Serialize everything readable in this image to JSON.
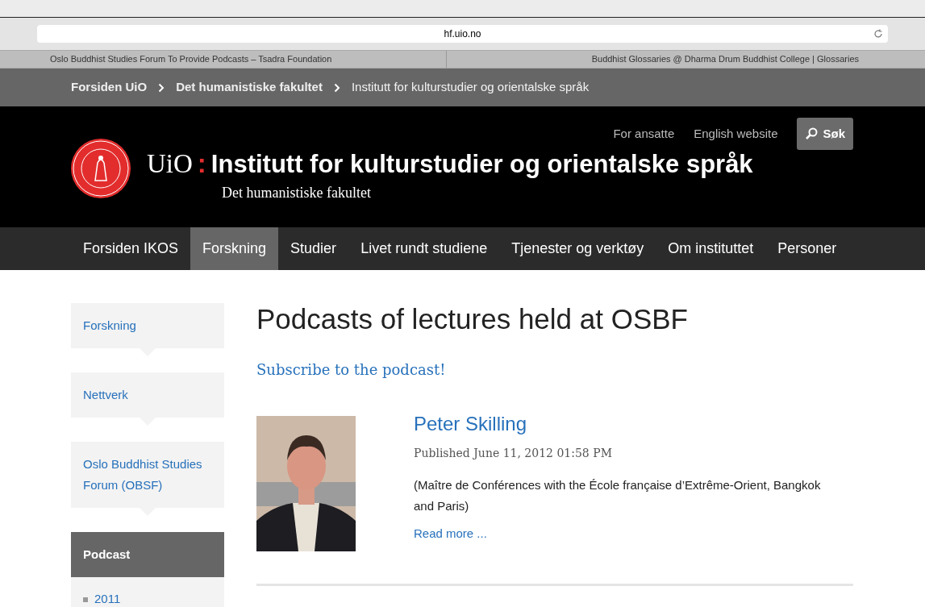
{
  "browser": {
    "address": "hf.uio.no",
    "tabs": [
      {
        "title": "Oslo Buddhist Studies Forum To Provide Podcasts – Tsadra Foundation"
      },
      {
        "title": "Buddhist Glossaries @ Dharma Drum Buddhist College | Glossaries"
      }
    ]
  },
  "breadcrumb": [
    {
      "label": "Forsiden UiO",
      "link": true
    },
    {
      "label": "Det humanistiske fakultet",
      "link": true
    },
    {
      "label": "Institutt for kulturstudier og orientalske språk",
      "link": false
    }
  ],
  "header": {
    "top_links": [
      "For ansatte",
      "English website"
    ],
    "search_button": "Søk",
    "brand": "UiO",
    "separator": ":",
    "title": "Institutt for kulturstudier og orientalske språk",
    "subtitle": "Det humanistiske fakultet"
  },
  "nav": [
    {
      "label": "Forsiden IKOS",
      "selected": false
    },
    {
      "label": "Forskning",
      "selected": true
    },
    {
      "label": "Studier",
      "selected": false
    },
    {
      "label": "Livet rundt studiene",
      "selected": false
    },
    {
      "label": "Tjenester og verktøy",
      "selected": false
    },
    {
      "label": "Om instituttet",
      "selected": false
    },
    {
      "label": "Personer",
      "selected": false
    }
  ],
  "sidebar": [
    {
      "label": "Forskning",
      "selected": false
    },
    {
      "label": "Nettverk",
      "selected": false
    },
    {
      "label": "Oslo Buddhist Studies Forum (OBSF)",
      "selected": false
    },
    {
      "label": "Podcast",
      "selected": true,
      "children": [
        {
          "label": "2011",
          "selected": false
        }
      ]
    }
  ],
  "main": {
    "heading": "Podcasts of lectures held at OSBF",
    "subscribe_link": "Subscribe to the podcast!",
    "articles": [
      {
        "title": "Peter Skilling",
        "published": "Published June 11, 2012 01:58 PM",
        "summary": "(Maître de Conférences with the École française d’Extrême-Orient, Bangkok and Paris)",
        "read_more": "Read more ..."
      }
    ]
  }
}
